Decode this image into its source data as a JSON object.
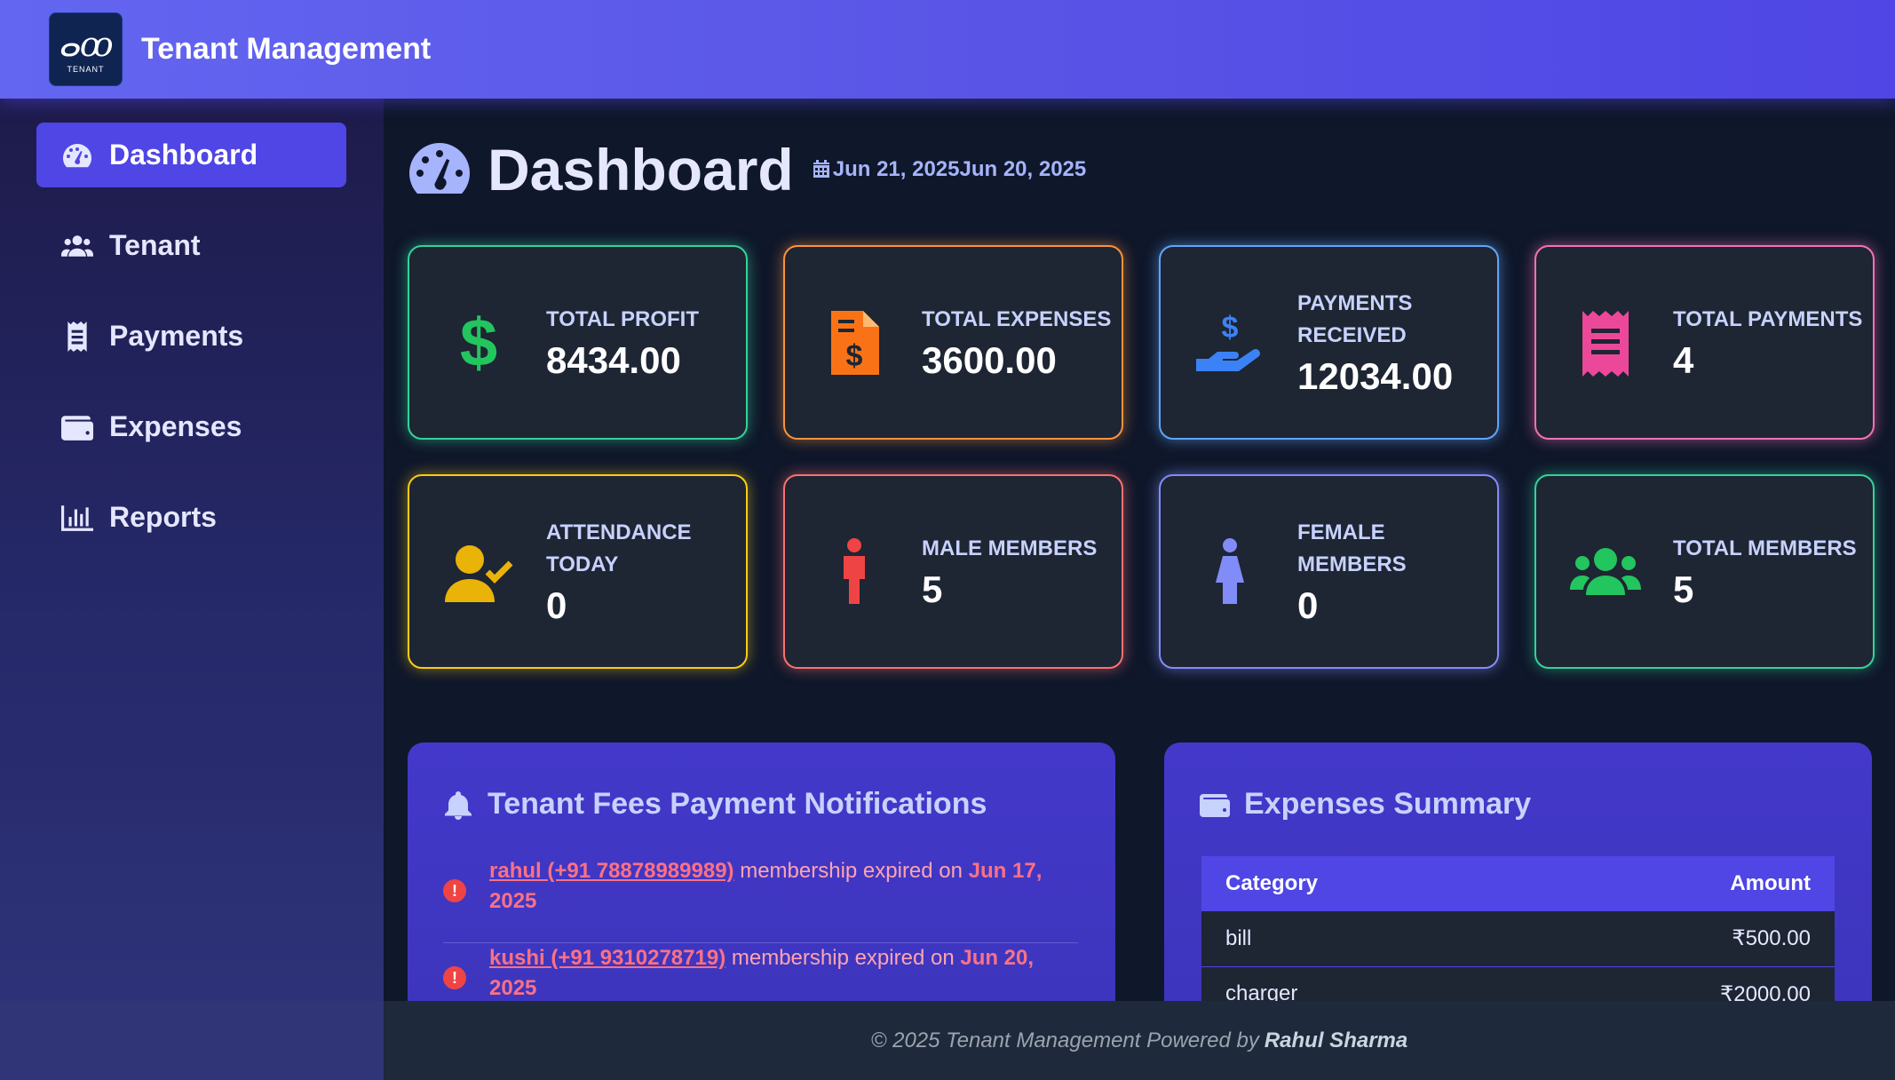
{
  "header": {
    "logo_text": "TENANT",
    "app_title": "Tenant Management"
  },
  "sidebar": {
    "items": [
      {
        "label": "Dashboard",
        "icon": "gauge-icon",
        "active": true
      },
      {
        "label": "Tenant",
        "icon": "users-icon",
        "active": false
      },
      {
        "label": "Payments",
        "icon": "receipt-icon",
        "active": false
      },
      {
        "label": "Expenses",
        "icon": "wallet-icon",
        "active": false
      },
      {
        "label": "Reports",
        "icon": "chart-bar-icon",
        "active": false
      }
    ]
  },
  "page": {
    "title": "Dashboard",
    "date_range": "Jun 21, 2025Jun 20, 2025"
  },
  "stats": [
    {
      "label": "TOTAL PROFIT",
      "value": "8434.00",
      "icon": "dollar-icon",
      "color": "#22c55e"
    },
    {
      "label": "TOTAL EXPENSES",
      "value": "3600.00",
      "icon": "invoice-dollar-icon",
      "color": "#f97316"
    },
    {
      "label": "PAYMENTS RECEIVED",
      "value": "12034.00",
      "icon": "hand-holding-dollar-icon",
      "color": "#3b82f6"
    },
    {
      "label": "TOTAL PAYMENTS",
      "value": "4",
      "icon": "receipt-icon",
      "color": "#ec4899"
    },
    {
      "label": "ATTENDANCE TODAY",
      "value": "0",
      "icon": "user-check-icon",
      "color": "#eab308"
    },
    {
      "label": "MALE MEMBERS",
      "value": "5",
      "icon": "male-icon",
      "color": "#ef4444"
    },
    {
      "label": "FEMALE MEMBERS",
      "value": "0",
      "icon": "female-icon",
      "color": "#818cf8"
    },
    {
      "label": "TOTAL MEMBERS",
      "value": "5",
      "icon": "users-icon",
      "color": "#22c55e"
    }
  ],
  "notifications": {
    "title": "Tenant Fees Payment Notifications",
    "items": [
      {
        "name": "rahul (+91 78878989989)",
        "message": " membership expired on ",
        "date": "Jun 17, 2025"
      },
      {
        "name": "kushi (+91 9310278719)",
        "message": " membership expired on ",
        "date": "Jun 20, 2025"
      }
    ]
  },
  "expenses": {
    "title": "Expenses Summary",
    "columns": [
      "Category",
      "Amount"
    ],
    "rows": [
      {
        "category": "bill",
        "amount": "₹500.00"
      },
      {
        "category": "charger",
        "amount": "₹2000.00"
      }
    ]
  },
  "footer": {
    "text": "© 2025 Tenant Management Powered by",
    "author": "Rahul Sharma"
  }
}
